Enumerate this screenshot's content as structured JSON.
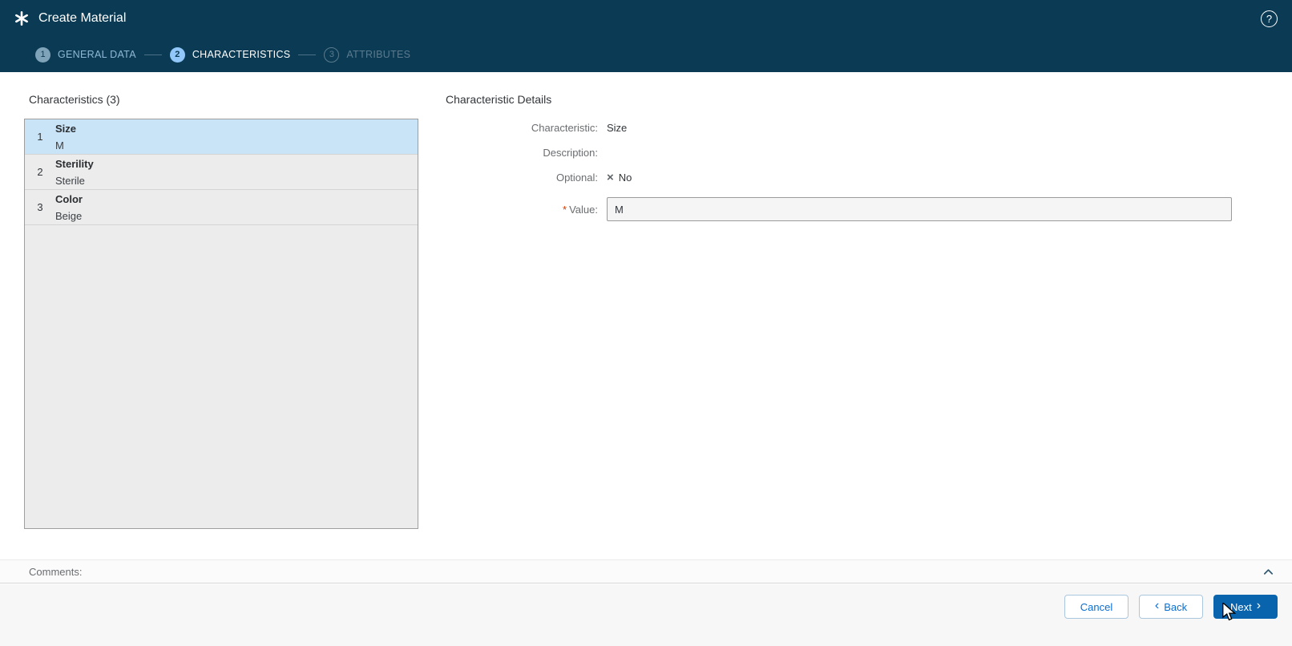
{
  "header": {
    "title": "Create Material",
    "help_glyph": "?"
  },
  "steps": [
    {
      "number": "1",
      "label": "GENERAL DATA",
      "state": "done"
    },
    {
      "number": "2",
      "label": "CHARACTERISTICS",
      "state": "active"
    },
    {
      "number": "3",
      "label": "ATTRIBUTES",
      "state": "upcoming"
    }
  ],
  "characteristics": {
    "title": "Characteristics (3)",
    "rows": [
      {
        "index": "1",
        "name": "Size",
        "value": "M",
        "selected": true
      },
      {
        "index": "2",
        "name": "Sterility",
        "value": "Sterile",
        "selected": false
      },
      {
        "index": "3",
        "name": "Color",
        "value": "Beige",
        "selected": false
      }
    ]
  },
  "details": {
    "title": "Characteristic Details",
    "characteristic_label": "Characteristic:",
    "characteristic_value": "Size",
    "description_label": "Description:",
    "description_value": "",
    "optional_label": "Optional:",
    "optional_icon": "×",
    "optional_value": "No",
    "required_marker": "*",
    "value_label": "Value:",
    "value_input": "M"
  },
  "comments": {
    "label": "Comments:"
  },
  "footer": {
    "cancel_label": "Cancel",
    "back_label": "Back",
    "back_chevron": "‹",
    "next_label": "Next",
    "next_chevron": "›"
  },
  "colors": {
    "header_bg": "#0b3b54",
    "accent": "#0a6ed1",
    "primary_button": "#0a64ad",
    "selected_row": "#c9e3f7",
    "required": "#ce3b01"
  }
}
